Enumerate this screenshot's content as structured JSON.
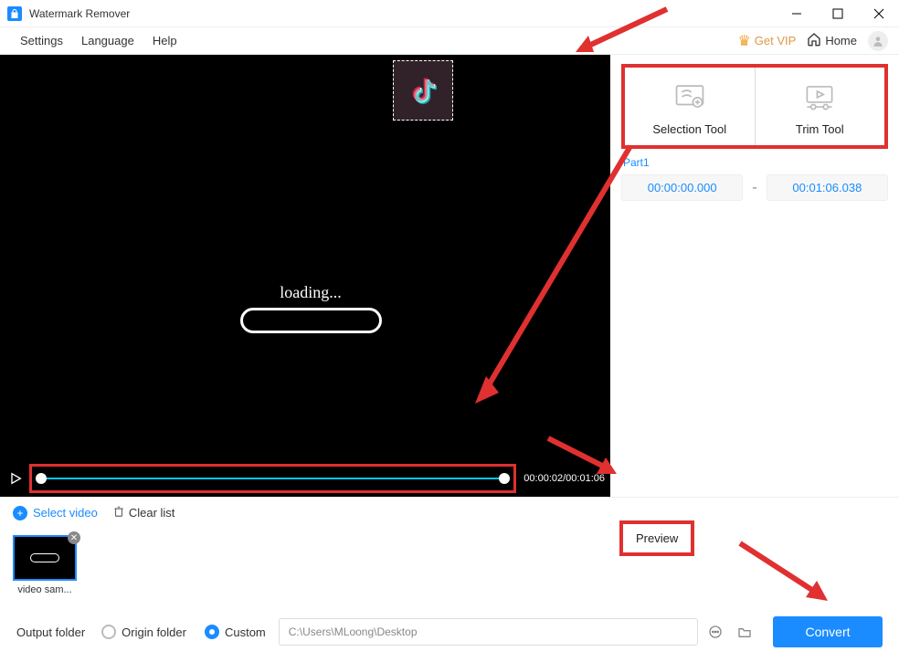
{
  "app": {
    "title": "Watermark Remover"
  },
  "menubar": {
    "settings": "Settings",
    "language": "Language",
    "help": "Help",
    "get_vip": "Get VIP",
    "home": "Home"
  },
  "tools": {
    "selection": "Selection Tool",
    "trim": "Trim Tool"
  },
  "part": {
    "label": "Part1",
    "start": "00:00:00.000",
    "end": "00:01:06.038",
    "dash": "-"
  },
  "player": {
    "time": "00:00:02/00:01:06",
    "loading": "loading..."
  },
  "preview": "Preview",
  "list": {
    "select": "Select video",
    "clear": "Clear list"
  },
  "thumb": {
    "label": "video sam..."
  },
  "output": {
    "label": "Output folder",
    "origin": "Origin folder",
    "custom": "Custom",
    "path": "C:\\Users\\MLoong\\Desktop",
    "convert": "Convert"
  }
}
